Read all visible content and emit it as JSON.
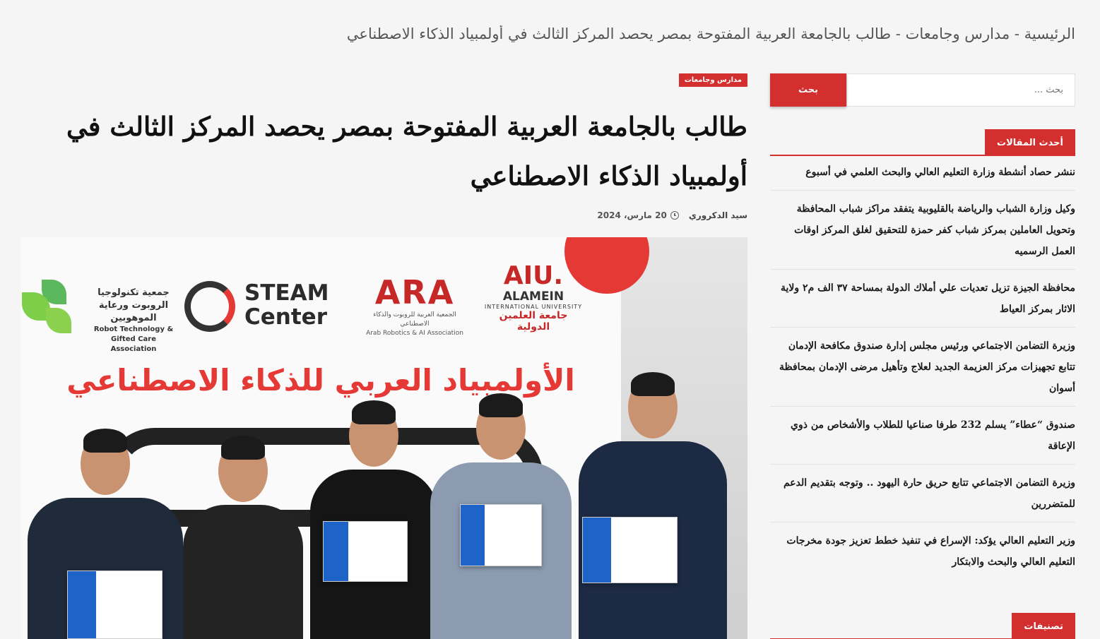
{
  "breadcrumb": {
    "home": "الرئيسية",
    "sep1": " - ",
    "section": "مدارس وجامعات",
    "sep2": " - ",
    "current": "طالب بالجامعة العربية المفتوحة بمصر يحصد المركز الثالث في أولمبياد الذكاء الاصطناعي"
  },
  "search": {
    "placeholder": "بحث ...",
    "button_label": "بحث"
  },
  "latest": {
    "title": "أحدث المقالات",
    "items": [
      "ننشر حصاد أنشطة وزارة التعليم العالي والبحث العلمي في أسبوع",
      "وكيل وزارة الشباب والرياضة بالقليوبية يتفقد مراكز شباب المحافظة وتحويل العاملين بمركز شباب كفر حمزة للتحقيق لغلق المركز اوقات العمل الرسميه",
      "محافظة الجيزة تزيل تعديات علي أملاك الدولة بمساحة ٣٧ الف م٢ ولاية الاثار بمركز العياط",
      "وزيرة التضامن الاجتماعي ورئيس مجلس إدارة صندوق مكافحة الإدمان تتابع تجهيزات مركز العزيمة الجديد لعلاج وتأهيل مرضى الإدمان بمحافظة أسوان",
      "صندوق “عطاء” يسلم 232 طرفا صناعيا للطلاب والأشخاص من ذوي الإعاقة",
      "وزيرة التضامن الاجتماعي تتابع حريق حارة اليهود .. وتوجه بتقديم الدعم للمتضررين",
      "وزير التعليم العالي يؤكد: الإسراع في تنفيذ خطط تعزيز جودة مخرجات التعليم العالي والبحث والابتكار"
    ]
  },
  "categories": {
    "title": "تصنيفات"
  },
  "article": {
    "category": "مدارس وجامعات",
    "headline": "طالب بالجامعة العربية المفتوحة بمصر يحصد المركز الثالث في أولمبياد الذكاء الاصطناعي",
    "author": "سيد الدكروري",
    "date": "20 مارس، 2024"
  },
  "photo": {
    "robot_assoc_ar": "جمعية تكنولوجيا الروبوت ورعاية الموهوبين",
    "robot_assoc_en": "Robot Technology & Gifted Care Association",
    "steam_line1": "STEAM",
    "steam_line2": "Center",
    "ara_mark": "ARA",
    "ara_ar": "الجمعية العربية للروبوت والذكاء الاصطناعي",
    "ara_en": "Arab Robotics & AI Association",
    "aiu_mark": "AIU.",
    "aiu_name": "ALAMEIN",
    "aiu_sub": "INTERNATIONAL UNIVERSITY",
    "aiu_ar": "جامعة العلمين الدولية",
    "olympiad": "الأولمبياد العربي للذكاء الاصطناعي"
  },
  "colors": {
    "accent": "#d32f2f",
    "background": "#f5f5f5"
  },
  "icons": [
    "clock-icon"
  ]
}
